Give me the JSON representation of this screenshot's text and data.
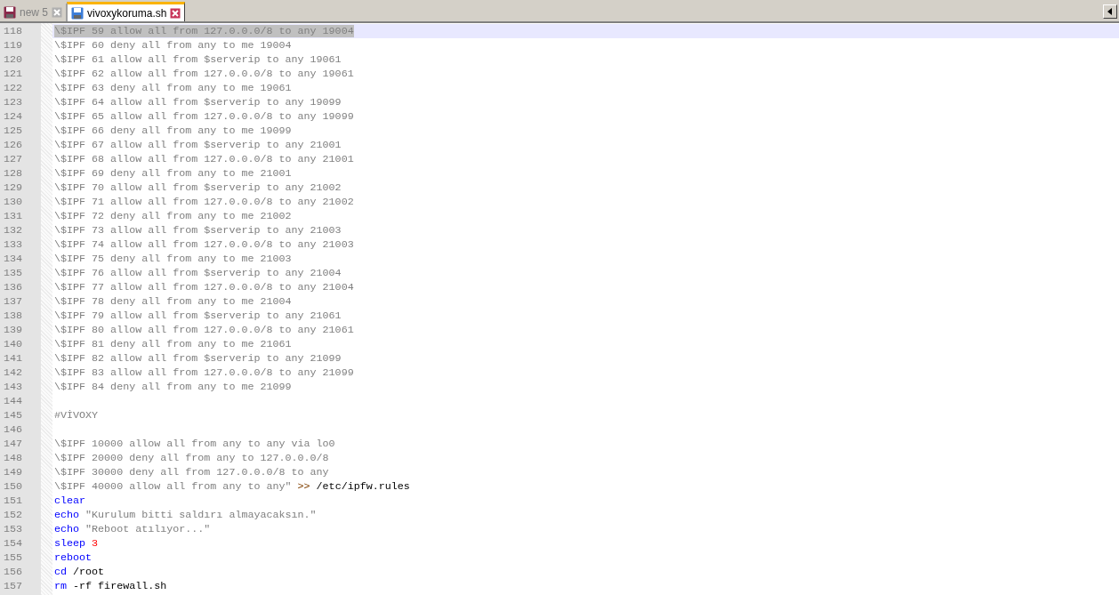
{
  "tabs": [
    {
      "label": "new 5",
      "selected": false,
      "modified": true
    },
    {
      "label": "vivoxykoruma.sh",
      "selected": true,
      "modified": false
    }
  ],
  "editor": {
    "lines": [
      {
        "number": "118",
        "current": true,
        "selected": true,
        "tokens": [
          {
            "kind": "string",
            "text": "\\$IPF 59 allow all from 127.0.0.0/8 to any 19004"
          }
        ]
      },
      {
        "number": "119",
        "current": false,
        "selected": false,
        "tokens": [
          {
            "kind": "string",
            "text": "\\$IPF 60 deny all from any to me 19004"
          }
        ]
      },
      {
        "number": "120",
        "current": false,
        "selected": false,
        "tokens": [
          {
            "kind": "string",
            "text": "\\$IPF 61 allow all from $serverip to any 19061"
          }
        ]
      },
      {
        "number": "121",
        "current": false,
        "selected": false,
        "tokens": [
          {
            "kind": "string",
            "text": "\\$IPF 62 allow all from 127.0.0.0/8 to any 19061"
          }
        ]
      },
      {
        "number": "122",
        "current": false,
        "selected": false,
        "tokens": [
          {
            "kind": "string",
            "text": "\\$IPF 63 deny all from any to me 19061"
          }
        ]
      },
      {
        "number": "123",
        "current": false,
        "selected": false,
        "tokens": [
          {
            "kind": "string",
            "text": "\\$IPF 64 allow all from $serverip to any 19099"
          }
        ]
      },
      {
        "number": "124",
        "current": false,
        "selected": false,
        "tokens": [
          {
            "kind": "string",
            "text": "\\$IPF 65 allow all from 127.0.0.0/8 to any 19099"
          }
        ]
      },
      {
        "number": "125",
        "current": false,
        "selected": false,
        "tokens": [
          {
            "kind": "string",
            "text": "\\$IPF 66 deny all from any to me 19099"
          }
        ]
      },
      {
        "number": "126",
        "current": false,
        "selected": false,
        "tokens": [
          {
            "kind": "string",
            "text": "\\$IPF 67 allow all from $serverip to any 21001"
          }
        ]
      },
      {
        "number": "127",
        "current": false,
        "selected": false,
        "tokens": [
          {
            "kind": "string",
            "text": "\\$IPF 68 allow all from 127.0.0.0/8 to any 21001"
          }
        ]
      },
      {
        "number": "128",
        "current": false,
        "selected": false,
        "tokens": [
          {
            "kind": "string",
            "text": "\\$IPF 69 deny all from any to me 21001"
          }
        ]
      },
      {
        "number": "129",
        "current": false,
        "selected": false,
        "tokens": [
          {
            "kind": "string",
            "text": "\\$IPF 70 allow all from $serverip to any 21002"
          }
        ]
      },
      {
        "number": "130",
        "current": false,
        "selected": false,
        "tokens": [
          {
            "kind": "string",
            "text": "\\$IPF 71 allow all from 127.0.0.0/8 to any 21002"
          }
        ]
      },
      {
        "number": "131",
        "current": false,
        "selected": false,
        "tokens": [
          {
            "kind": "string",
            "text": "\\$IPF 72 deny all from any to me 21002"
          }
        ]
      },
      {
        "number": "132",
        "current": false,
        "selected": false,
        "tokens": [
          {
            "kind": "string",
            "text": "\\$IPF 73 allow all from $serverip to any 21003"
          }
        ]
      },
      {
        "number": "133",
        "current": false,
        "selected": false,
        "tokens": [
          {
            "kind": "string",
            "text": "\\$IPF 74 allow all from 127.0.0.0/8 to any 21003"
          }
        ]
      },
      {
        "number": "134",
        "current": false,
        "selected": false,
        "tokens": [
          {
            "kind": "string",
            "text": "\\$IPF 75 deny all from any to me 21003"
          }
        ]
      },
      {
        "number": "135",
        "current": false,
        "selected": false,
        "tokens": [
          {
            "kind": "string",
            "text": "\\$IPF 76 allow all from $serverip to any 21004"
          }
        ]
      },
      {
        "number": "136",
        "current": false,
        "selected": false,
        "tokens": [
          {
            "kind": "string",
            "text": "\\$IPF 77 allow all from 127.0.0.0/8 to any 21004"
          }
        ]
      },
      {
        "number": "137",
        "current": false,
        "selected": false,
        "tokens": [
          {
            "kind": "string",
            "text": "\\$IPF 78 deny all from any to me 21004"
          }
        ]
      },
      {
        "number": "138",
        "current": false,
        "selected": false,
        "tokens": [
          {
            "kind": "string",
            "text": "\\$IPF 79 allow all from $serverip to any 21061"
          }
        ]
      },
      {
        "number": "139",
        "current": false,
        "selected": false,
        "tokens": [
          {
            "kind": "string",
            "text": "\\$IPF 80 allow all from 127.0.0.0/8 to any 21061"
          }
        ]
      },
      {
        "number": "140",
        "current": false,
        "selected": false,
        "tokens": [
          {
            "kind": "string",
            "text": "\\$IPF 81 deny all from any to me 21061"
          }
        ]
      },
      {
        "number": "141",
        "current": false,
        "selected": false,
        "tokens": [
          {
            "kind": "string",
            "text": "\\$IPF 82 allow all from $serverip to any 21099"
          }
        ]
      },
      {
        "number": "142",
        "current": false,
        "selected": false,
        "tokens": [
          {
            "kind": "string",
            "text": "\\$IPF 83 allow all from 127.0.0.0/8 to any 21099"
          }
        ]
      },
      {
        "number": "143",
        "current": false,
        "selected": false,
        "tokens": [
          {
            "kind": "string",
            "text": "\\$IPF 84 deny all from any to me 21099"
          }
        ]
      },
      {
        "number": "144",
        "current": false,
        "selected": false
      },
      {
        "number": "145",
        "current": false,
        "selected": false,
        "tokens": [
          {
            "kind": "comment",
            "text": "#VİVOXY"
          }
        ]
      },
      {
        "number": "146",
        "current": false,
        "selected": false
      },
      {
        "number": "147",
        "current": false,
        "selected": false,
        "tokens": [
          {
            "kind": "string",
            "text": "\\$IPF 10000 allow all from any to any via lo0"
          }
        ]
      },
      {
        "number": "148",
        "current": false,
        "selected": false,
        "tokens": [
          {
            "kind": "string",
            "text": "\\$IPF 20000 deny all from any to 127.0.0.0/8"
          }
        ]
      },
      {
        "number": "149",
        "current": false,
        "selected": false,
        "tokens": [
          {
            "kind": "string",
            "text": "\\$IPF 30000 deny all from 127.0.0.0/8 to any"
          }
        ]
      },
      {
        "number": "150",
        "current": false,
        "selected": false,
        "tokens": [
          {
            "kind": "string",
            "text": "\\$IPF 40000 allow all from any to any\""
          },
          {
            "kind": "operator",
            "text": " >>"
          },
          {
            "kind": "plain",
            "text": " /etc/ipfw.rules"
          }
        ]
      },
      {
        "number": "151",
        "current": false,
        "selected": false,
        "tokens": [
          {
            "kind": "keyword",
            "text": "clear"
          }
        ]
      },
      {
        "number": "152",
        "current": false,
        "selected": false,
        "tokens": [
          {
            "kind": "keyword",
            "text": "echo"
          },
          {
            "kind": "string",
            "text": " \"Kurulum bitti saldırı almayacaksın.\""
          }
        ]
      },
      {
        "number": "153",
        "current": false,
        "selected": false,
        "tokens": [
          {
            "kind": "keyword",
            "text": "echo"
          },
          {
            "kind": "string",
            "text": " \"Reboot atılıyor...\""
          }
        ]
      },
      {
        "number": "154",
        "current": false,
        "selected": false,
        "tokens": [
          {
            "kind": "keyword",
            "text": "sleep"
          },
          {
            "kind": "number",
            "text": " 3"
          }
        ]
      },
      {
        "number": "155",
        "current": false,
        "selected": false,
        "tokens": [
          {
            "kind": "keyword",
            "text": "reboot"
          }
        ]
      },
      {
        "number": "156",
        "current": false,
        "selected": false,
        "tokens": [
          {
            "kind": "keyword",
            "text": "cd"
          },
          {
            "kind": "plain",
            "text": " /root"
          }
        ]
      },
      {
        "number": "157",
        "current": false,
        "selected": false,
        "tokens": [
          {
            "kind": "keyword",
            "text": "rm"
          },
          {
            "kind": "plain",
            "text": " -rf firewall.sh"
          }
        ]
      }
    ]
  }
}
